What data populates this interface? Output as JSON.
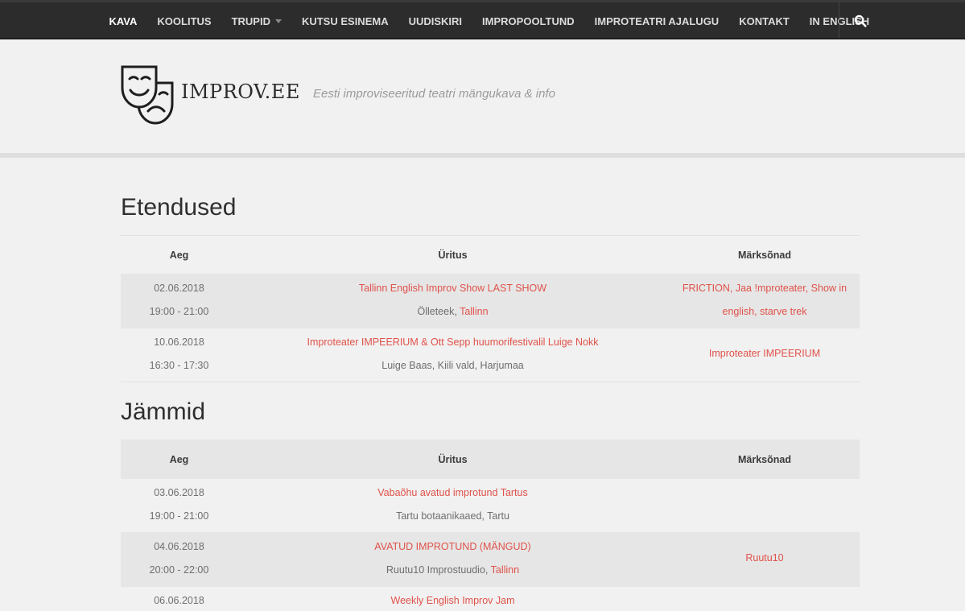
{
  "nav": {
    "items": [
      {
        "label": "KAVA"
      },
      {
        "label": "KOOLITUS"
      },
      {
        "label": "TRUPID"
      },
      {
        "label": "KUTSU ESINEMA"
      },
      {
        "label": "UUDISKIRI"
      },
      {
        "label": "IMPROPOOLTUND"
      },
      {
        "label": "IMPROTEATRI AJALUGU"
      },
      {
        "label": "KONTAKT"
      },
      {
        "label": "IN ENGLISH"
      }
    ],
    "search_icon": "search-icon"
  },
  "header": {
    "site_name": "IMPROV.EE",
    "tagline": "Eesti improviseeritud teatri mängukava & info",
    "logo_icon": "theatre-masks-icon"
  },
  "performances": {
    "title": "Etendused",
    "headers": {
      "time": "Aeg",
      "event": "Üritus",
      "tags": "Märksõnad"
    },
    "rows": [
      {
        "date": "02.06.2018",
        "time": "19:00 - 21:00",
        "event": "Tallinn English Improv Show LAST SHOW",
        "venue": "Ölleteek",
        "city": "Tallinn",
        "tags": [
          "FRICTION",
          "Jaa !mproteater",
          "Show in english",
          "starve trek"
        ]
      },
      {
        "date": "10.06.2018",
        "time": "16:30 - 17:30",
        "event": "Improteater IMPEERIUM & Ott Sepp huumorifestivalil Luige Nokk",
        "venue_full": "Luige Baas, Kiili vald, Harjumaa",
        "tags": [
          "Improteater IMPEERIUM"
        ]
      }
    ]
  },
  "jams": {
    "title": "Jämmid",
    "headers": {
      "time": "Aeg",
      "event": "Üritus",
      "tags": "Märksõnad"
    },
    "rows": [
      {
        "date": "03.06.2018",
        "time": "19:00 - 21:00",
        "event": "Vabaõhu avatud improtund Tartus",
        "venue_full": "Tartu botaanikaaed, Tartu",
        "tags": []
      },
      {
        "date": "04.06.2018",
        "time": "20:00 - 22:00",
        "event": "AVATUD IMPROTUND (MÄNGUD)",
        "venue": "Ruutu10 Improstuudio",
        "city": "Tallinn",
        "tags": [
          "Ruutu10"
        ]
      },
      {
        "date": "06.06.2018",
        "event": "Weekly English Improv Jam"
      }
    ]
  },
  "colors": {
    "accent": "#e0524a",
    "navbar": "#2c2c2c",
    "background": "#f1f1f1",
    "row_shade": "#e6e6e6"
  }
}
